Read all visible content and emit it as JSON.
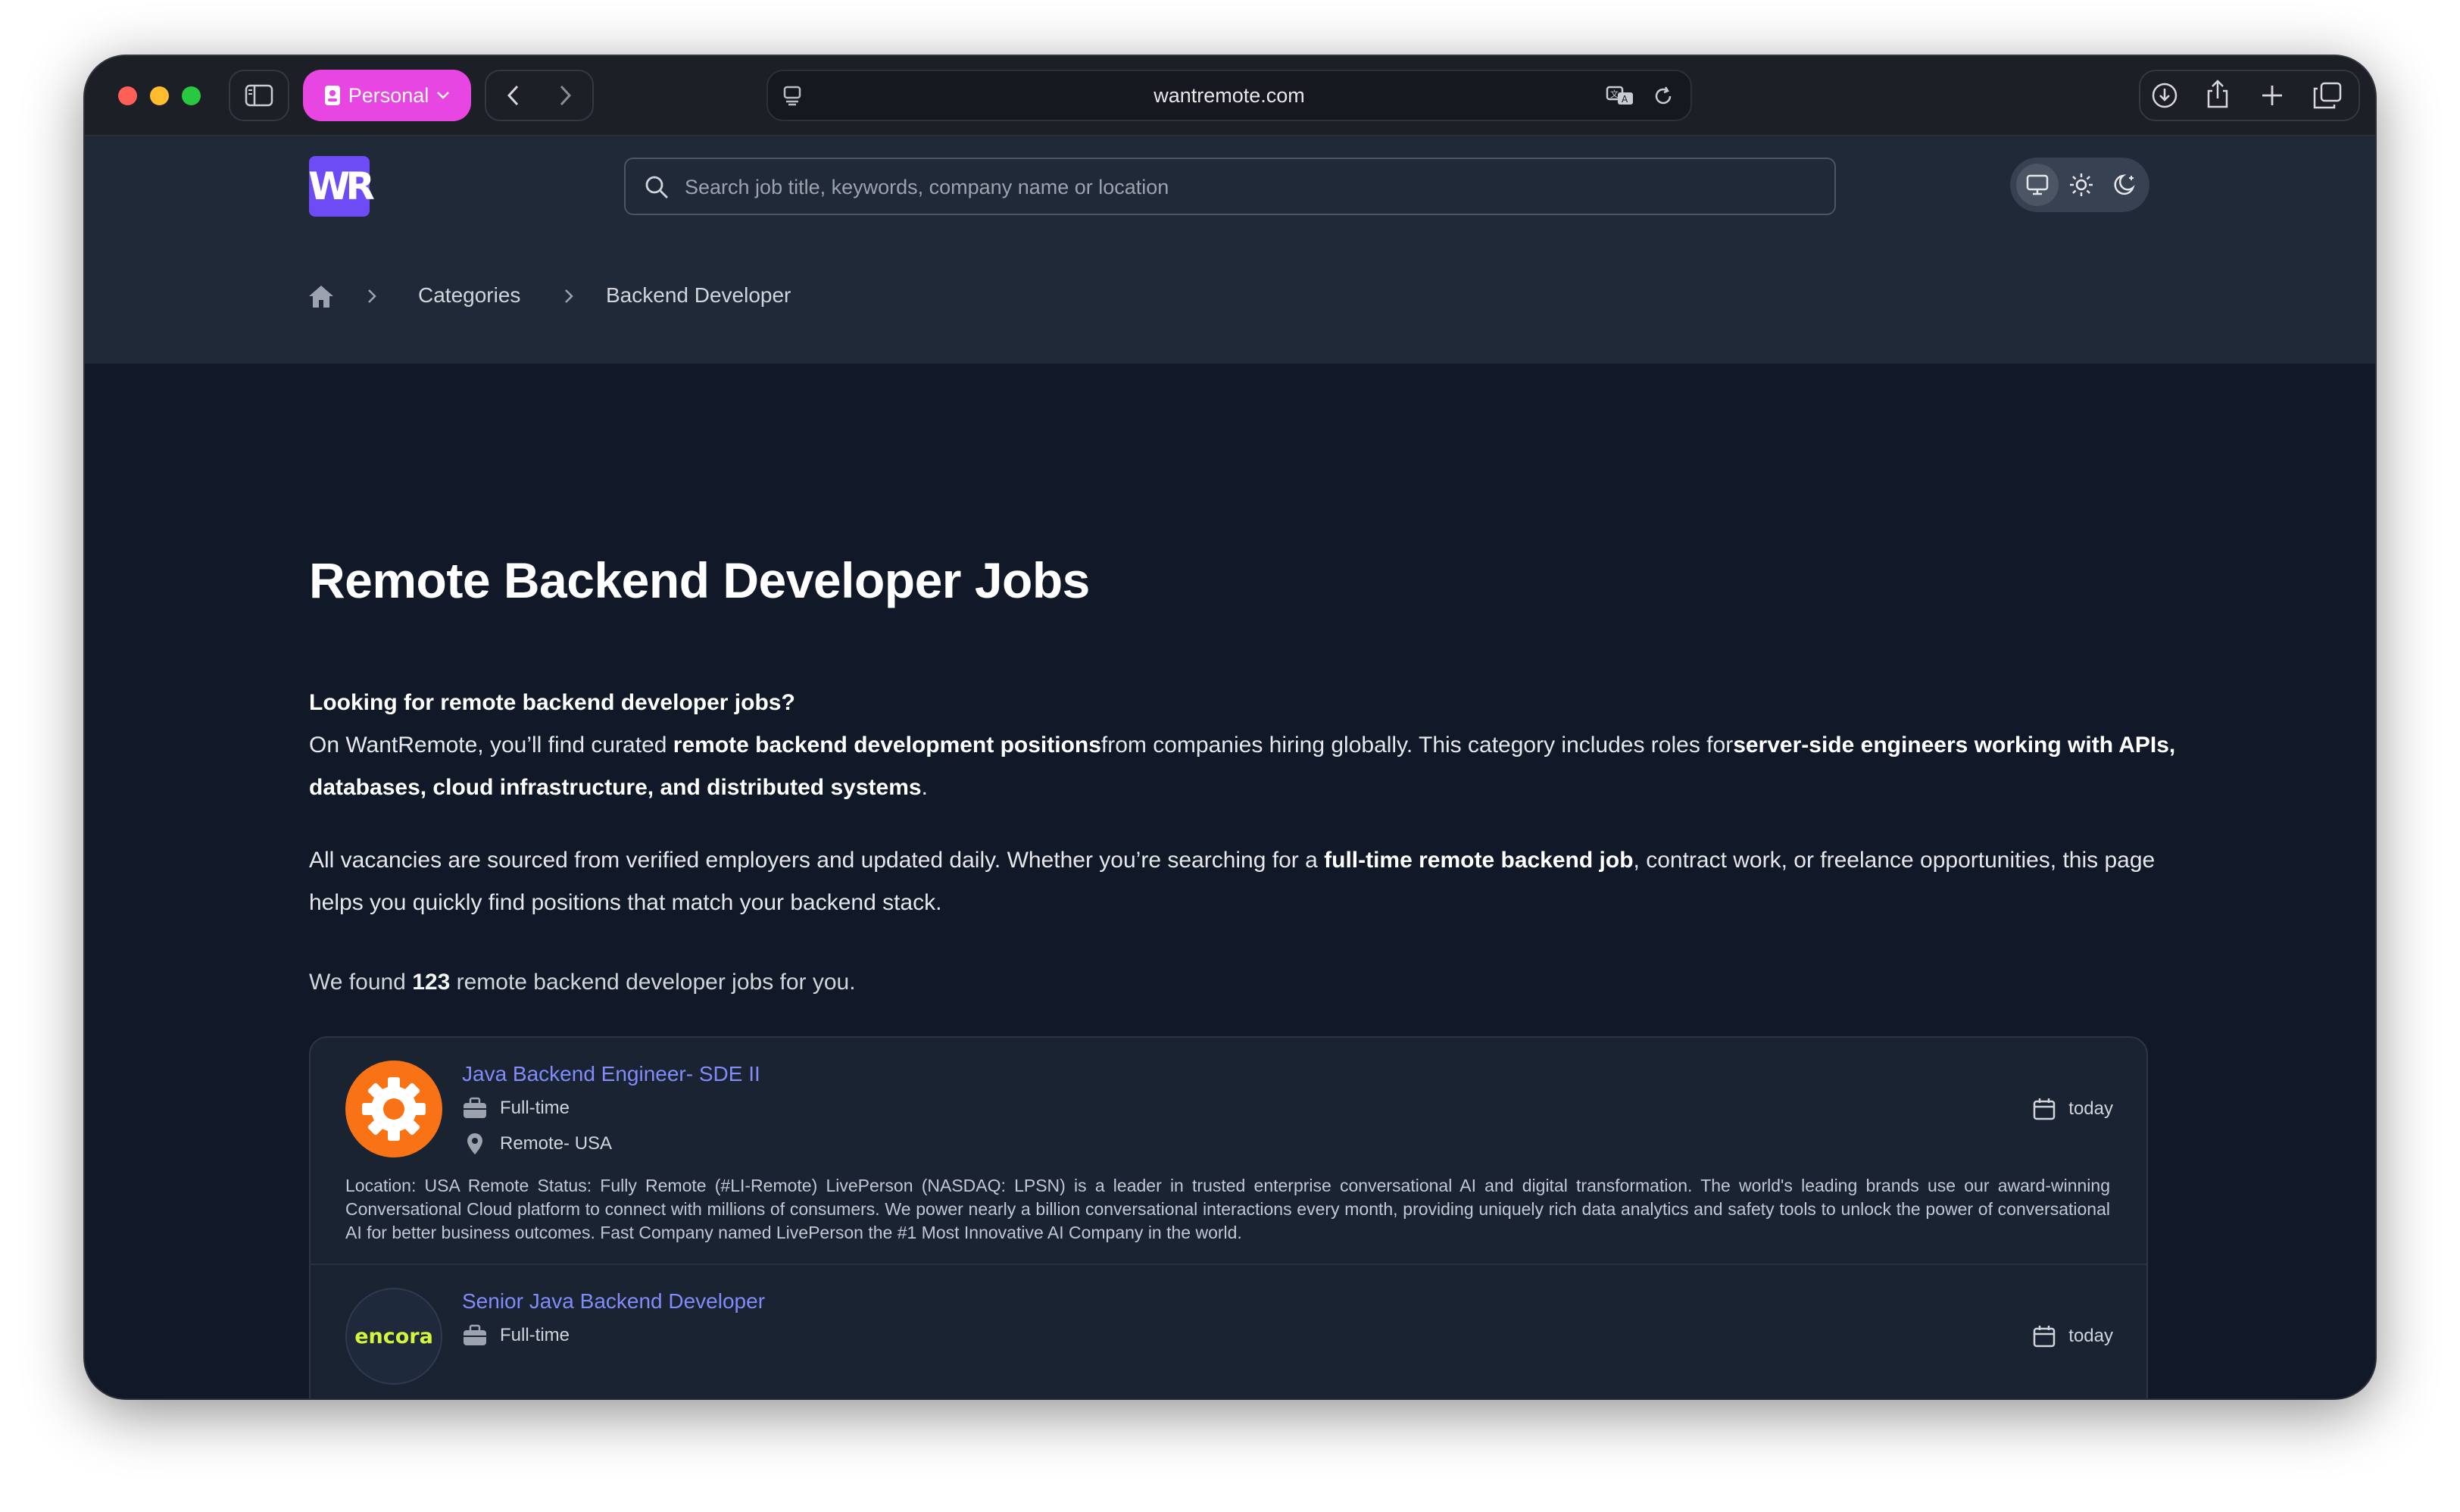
{
  "browser": {
    "profile_label": "Personal",
    "url": "wantremote.com",
    "colors": {
      "close": "#ff5f57",
      "minimize": "#febc2e",
      "maximize": "#28c840",
      "profile": "#e846e3"
    }
  },
  "header": {
    "logo_text": "WR",
    "search_placeholder": "Search job title, keywords, company name or location",
    "theme_options": [
      "monitor-icon",
      "sun-icon",
      "moon-icon"
    ]
  },
  "breadcrumb": {
    "home_icon": "home-icon",
    "items": [
      "Categories",
      "Backend Developer"
    ]
  },
  "main": {
    "title": "Remote Backend Developer Jobs",
    "intro_heading": "Looking for remote backend developer jobs?",
    "p1_a": "On WantRemote, you’ll find curated ",
    "p1_b": "remote backend development positions",
    "p1_c": "from companies hiring globally. This category includes roles for",
    "p1_d": "server-side engineers working with APIs, databases, cloud infrastructure, and distributed systems",
    "p1_e": ".",
    "p2_a": "All vacancies are sourced from verified employers and updated daily. Whether you’re searching for a ",
    "p2_b": "full-time remote backend job",
    "p2_c": ", contract work, or freelance opportunities, this page helps you quickly find positions that match your backend stack.",
    "found_a": "We found ",
    "found_count": "123",
    "found_b": " remote backend developer jobs for you."
  },
  "jobs": [
    {
      "title": "Java Backend Engineer- SDE II",
      "type": "Full-time",
      "location": "Remote- USA",
      "date": "today",
      "logo": "liveperson-logo",
      "description": "Location: USA  Remote Status: Fully Remote (#LI-Remote) LivePerson (NASDAQ: LPSN) is a leader in trusted enterprise conversational AI and digital transformation. The world's leading brands use our award-winning Conversational Cloud platform to connect with millions of consumers. We power nearly a billion conversational interactions every month, providing uniquely rich data analytics and safety tools to unlock the power of conversational AI for better business outcomes. Fast Company named LivePerson the #1 Most Innovative AI Company in the world."
    },
    {
      "title": "Senior Java Backend Developer",
      "type": "Full-time",
      "date": "today",
      "logo_text": "encora"
    }
  ]
}
